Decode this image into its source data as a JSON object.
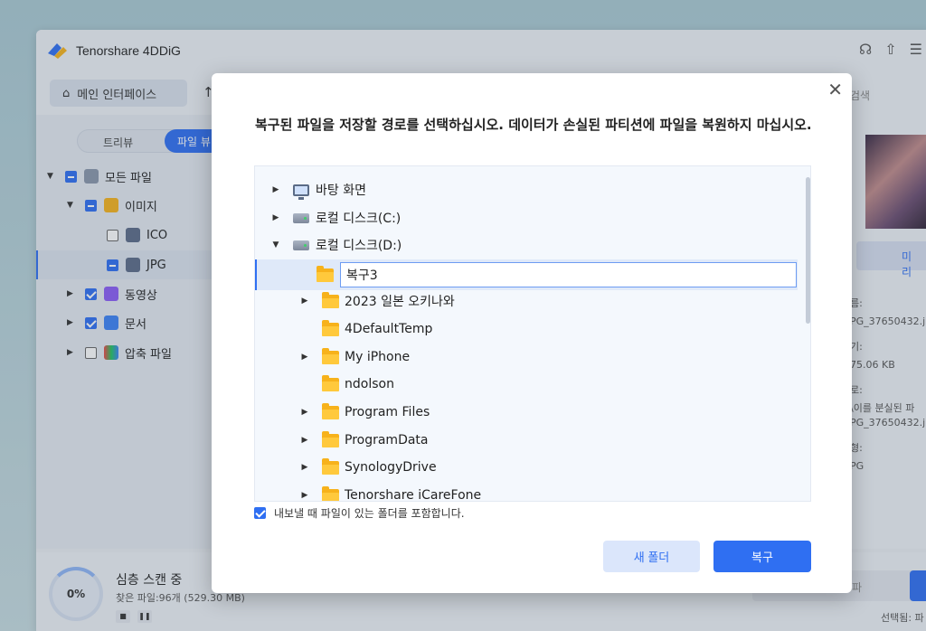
{
  "app": {
    "name": "Tenorshare 4DDiG",
    "home_label": "메인 인터페이스",
    "search_placeholder": "검색"
  },
  "left_panel": {
    "view_tabs": [
      "트리뷰",
      "파일 뷰"
    ],
    "tree": [
      {
        "label": "모든 파일",
        "state": "partial",
        "expanded": true
      },
      {
        "label": "이미지",
        "state": "partial",
        "expanded": true
      },
      {
        "label": "ICO",
        "state": "unchecked"
      },
      {
        "label": "JPG",
        "state": "partial",
        "selected": true
      },
      {
        "label": "동영상",
        "state": "checked"
      },
      {
        "label": "문서",
        "state": "checked"
      },
      {
        "label": "압축 파일",
        "state": "unchecked"
      }
    ]
  },
  "right_panel": {
    "preview_button": "미리",
    "meta": [
      {
        "label": "름:",
        "value": "PG_37650432.j"
      },
      {
        "label": "기:",
        "value": "75.06 KB"
      },
      {
        "label": "로:",
        "value": "\\이를 분실된 파"
      },
      {
        "label": "",
        "value": "PG_37650432.jp"
      },
      {
        "label": "형:",
        "value": "PG"
      }
    ]
  },
  "bottom_bar": {
    "progress": "0%",
    "scan_title": "심층 스캔 중",
    "scan_sub": "찾은 파일:96개 (529.30 MB)",
    "grey_button": "파",
    "selected_text": "선택됨: 파"
  },
  "dialog": {
    "message": "복구된 파일을 저장할 경로를 선택하십시오. 데이터가 손실된 파티션에 파일을 복원하지 마십시오.",
    "folders": [
      {
        "label": "바탕 화면",
        "icon": "monitor-icon",
        "level": 0,
        "caret": "right"
      },
      {
        "label": "로컬 디스크(C:)",
        "icon": "drive-icon",
        "level": 0,
        "caret": "right"
      },
      {
        "label": "로컬 디스크(D:)",
        "icon": "drive-icon",
        "level": 0,
        "caret": "down"
      },
      {
        "label": "복구3",
        "icon": "folder-icon",
        "level": 1,
        "caret": "",
        "editing": true
      },
      {
        "label": "2023 일본 오키나와",
        "icon": "folder-icon",
        "level": 1,
        "caret": "right"
      },
      {
        "label": "4DefaultTemp",
        "icon": "folder-icon",
        "level": 1,
        "caret": ""
      },
      {
        "label": "My iPhone",
        "icon": "folder-icon",
        "level": 1,
        "caret": "right"
      },
      {
        "label": "ndolson",
        "icon": "folder-icon",
        "level": 1,
        "caret": ""
      },
      {
        "label": "Program Files",
        "icon": "folder-icon",
        "level": 1,
        "caret": "right"
      },
      {
        "label": "ProgramData",
        "icon": "folder-icon",
        "level": 1,
        "caret": "right"
      },
      {
        "label": "SynologyDrive",
        "icon": "folder-icon",
        "level": 1,
        "caret": "right"
      },
      {
        "label": "Tenorshare iCareFone",
        "icon": "folder-icon",
        "level": 1,
        "caret": "right"
      }
    ],
    "new_folder_value": "복구3",
    "include_label": "내보낼 때 파일이 있는 폴더를 포함합니다.",
    "include_checked": true,
    "new_folder_button": "새 폴더",
    "recover_button": "복구"
  },
  "colors": {
    "accent": "#2f6ff2",
    "folder": "#f7b21b"
  }
}
